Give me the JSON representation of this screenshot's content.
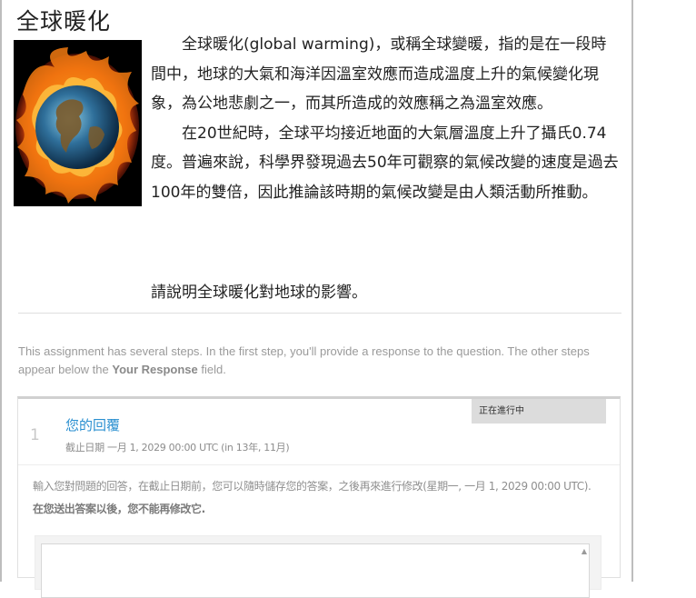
{
  "page": {
    "title": "全球暖化",
    "image_alt": "burning earth illustration"
  },
  "article": {
    "paragraphs": [
      "全球暖化(global warming)，或稱全球變暖，指的是在一段時間中，地球的大氣和海洋因溫室效應而造成溫度上升的氣候變化現象，為公地悲劇之一，而其所造成的效應稱之為溫室效應。",
      "在20世紀時，全球平均接近地面的大氣層溫度上升了攝氏0.74度。普遍來說，科學界發現過去50年可觀察的氣候改變的速度是過去100年的雙倍，因此推論該時期的氣候改變是由人類活動所推動。"
    ],
    "question": "請說明全球暖化對地球的影響。"
  },
  "assignment_note": {
    "text": "This assignment has several steps. In the first step, you'll provide a response to the question. The other steps appear below the ",
    "bold": "Your Response",
    "suffix": " field."
  },
  "step": {
    "number": "1",
    "title": "您的回覆",
    "status": "正在進行中",
    "due": "截止日期 一月 1, 2029 00:00 UTC (in 13年, 11月)",
    "instructions": "輸入您對問題的回答，在截止日期前，您可以隨時儲存您的答案，之後再來進行修改(星期一, 一月 1, 2029 00:00 UTC).",
    "warning": "在您送出答案以後，您不能再修改它."
  },
  "colors": {
    "link_blue": "#2a8fd0",
    "muted_text": "#9a9a9a",
    "badge_bg": "#dcdcdc"
  }
}
